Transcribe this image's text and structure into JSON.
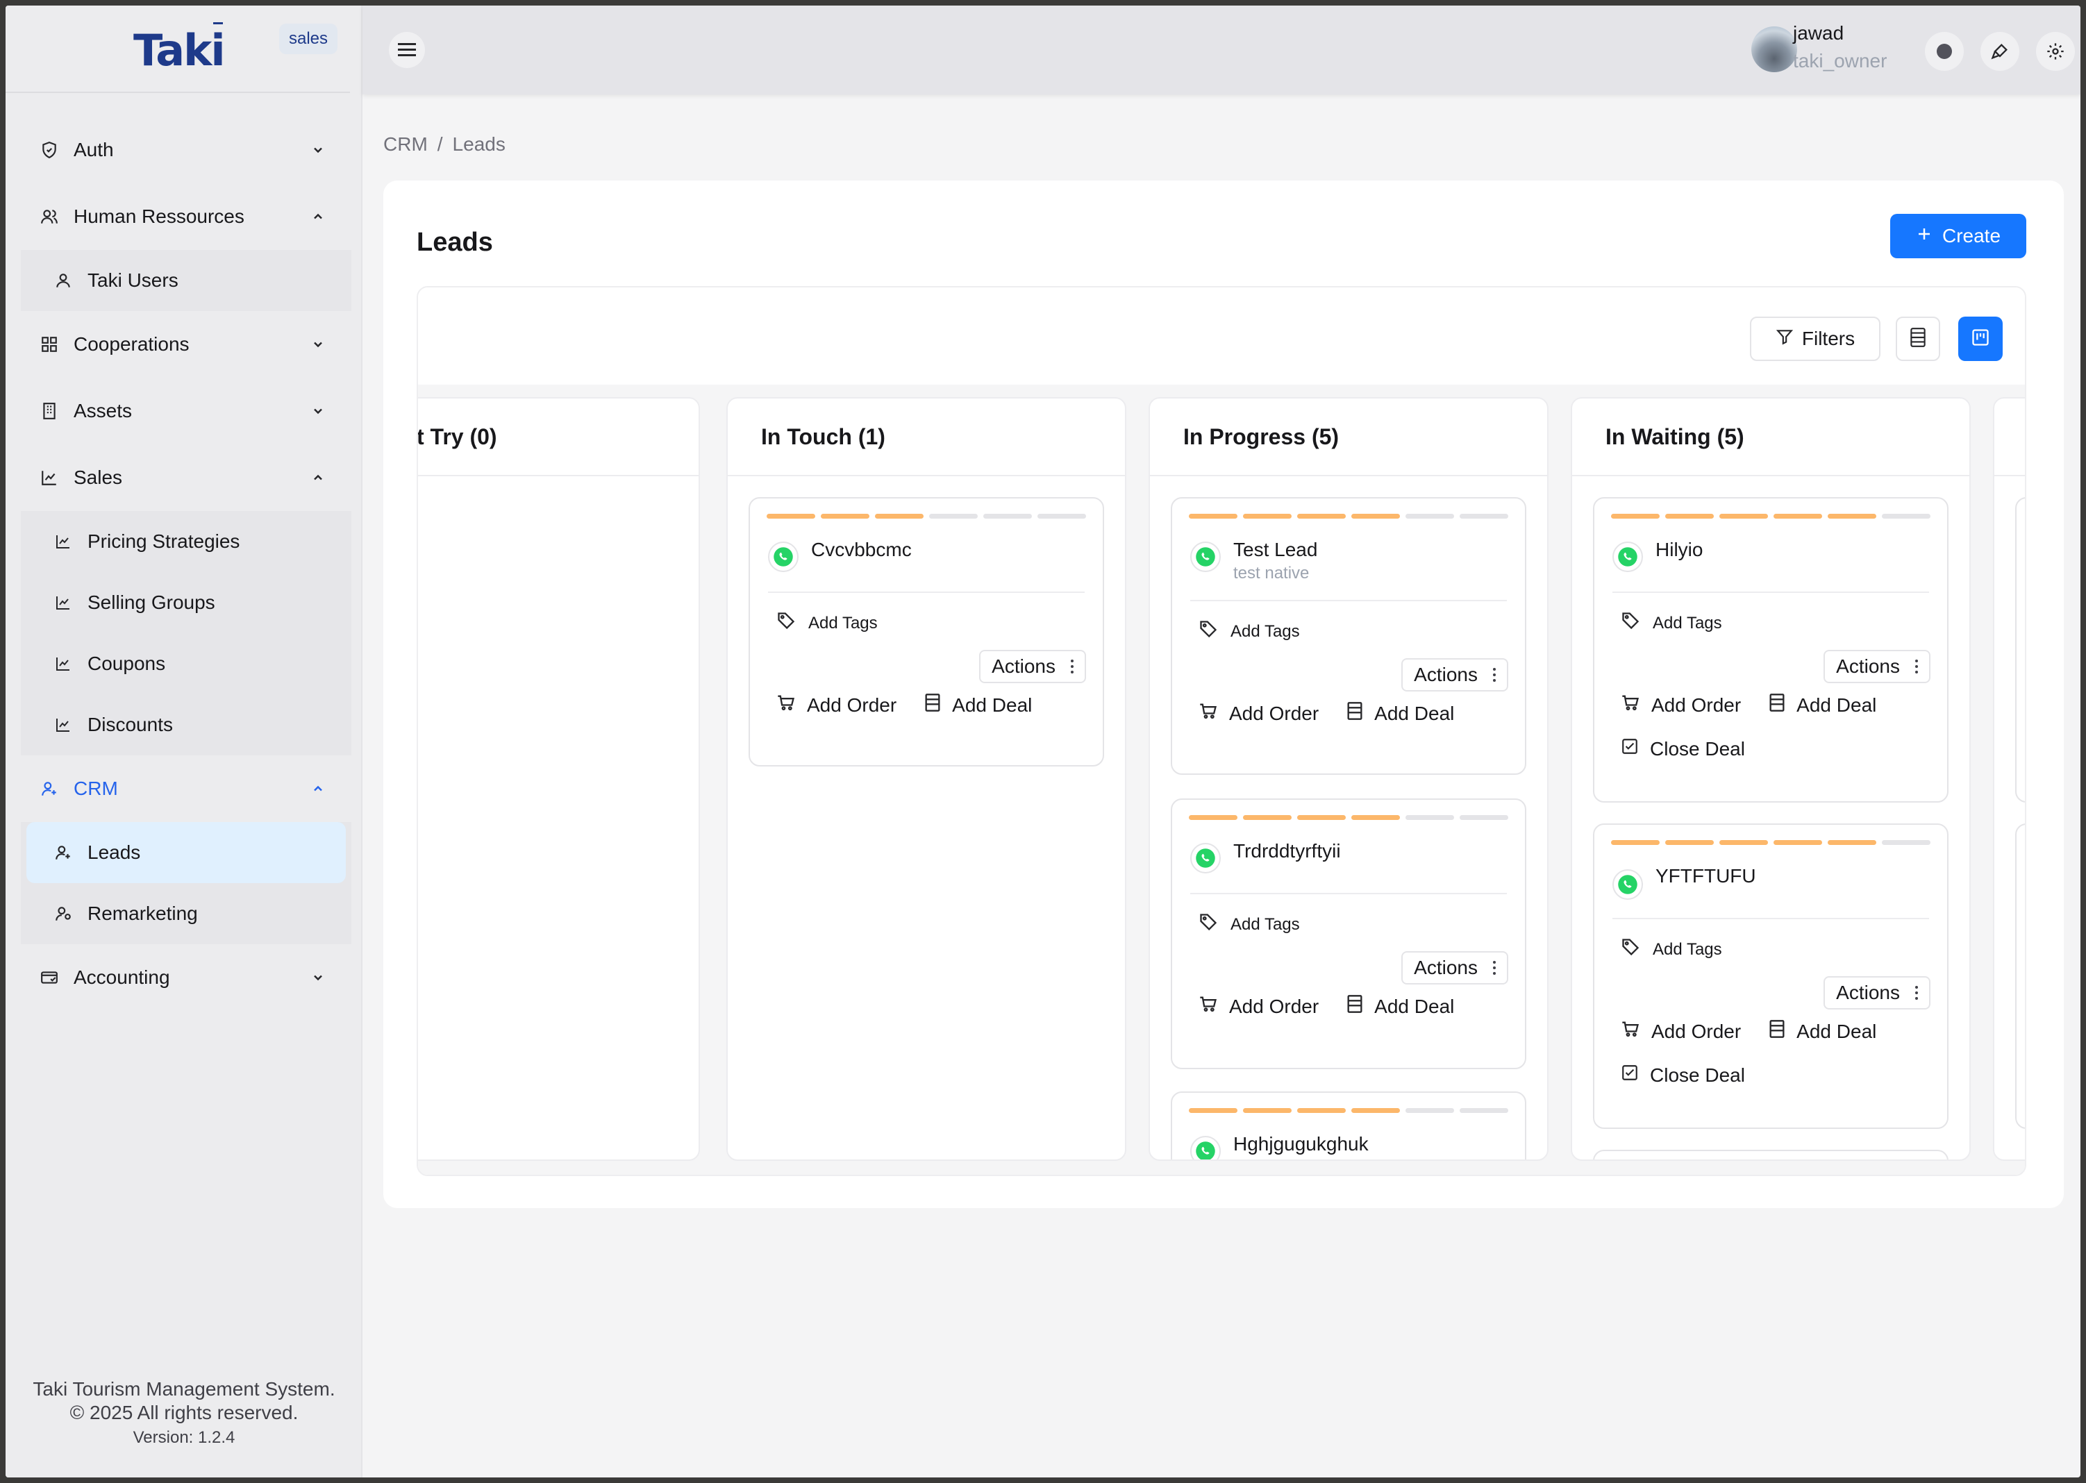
{
  "sidebar": {
    "logo": "Taki",
    "app_tag": "sales",
    "menu": {
      "auth": "Auth",
      "hr": "Human Ressources",
      "taki_users": "Taki Users",
      "cooperations": "Cooperations",
      "assets": "Assets",
      "sales": "Sales",
      "pricing": "Pricing Strategies",
      "selling_groups": "Selling Groups",
      "coupons": "Coupons",
      "discounts": "Discounts",
      "crm": "CRM",
      "leads": "Leads",
      "remarketing": "Remarketing",
      "accounting": "Accounting"
    },
    "footer": {
      "line1": "Taki Tourism Management System.",
      "line2": "© 2025 All rights reserved.",
      "line3": "Version: 1.2.4"
    }
  },
  "header": {
    "user_name": "jawad",
    "user_role": "taki_owner",
    "icons": [
      "menu-icon",
      "status-dot-icon",
      "brush-icon",
      "gear-icon"
    ]
  },
  "breadcrumb": {
    "root": "CRM",
    "sep": "/",
    "current": "Leads"
  },
  "page": {
    "title": "Leads",
    "create_label": "Create",
    "filters_label": "Filters"
  },
  "lanes": [
    {
      "title": "t Try (0)"
    },
    {
      "title": "In Touch (1)"
    },
    {
      "title": "In Progress (5)"
    },
    {
      "title": "In Waiting (5)"
    }
  ],
  "labels": {
    "add_tags": "Add Tags",
    "actions": "Actions",
    "add_order": "Add Order",
    "add_deal": "Add Deal",
    "close_deal": "Close Deal"
  },
  "leads": {
    "touch1": {
      "name": "Cvcvbbcmc",
      "progress": 3
    },
    "prog1": {
      "name": "Test Lead",
      "sub": "test native",
      "progress": 4
    },
    "prog2": {
      "name": "Trdrddtyrftyii",
      "progress": 4
    },
    "prog3": {
      "name": "Hghjgugukghuk",
      "progress": 4
    },
    "wait1": {
      "name": "Hilyio",
      "progress": 5
    },
    "wait2": {
      "name": "YFTFTUFU",
      "progress": 5
    }
  },
  "colors": {
    "accent": "#1677ff",
    "progress": "#fcb76a",
    "whatsapp": "#25d366",
    "crm_active": "#2563eb"
  }
}
